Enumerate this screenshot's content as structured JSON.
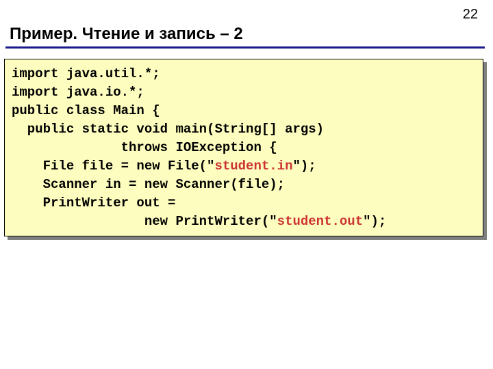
{
  "page_number": "22",
  "title": "Пример. Чтение и запись – 2",
  "code": {
    "line1": "import java.util.*;",
    "line2": "import java.io.*;",
    "line3": "public class Main {",
    "line4": "  public static void main(String[] args)",
    "line5": "              throws IOException {",
    "line6a": "    File file = new File(\"",
    "line6b": "student.in",
    "line6c": "\");",
    "line7": "    Scanner in = new Scanner(file);",
    "line8": "    PrintWriter out =",
    "line9a": "                 new PrintWriter(\"",
    "line9b": "student.out",
    "line9c": "\");"
  }
}
